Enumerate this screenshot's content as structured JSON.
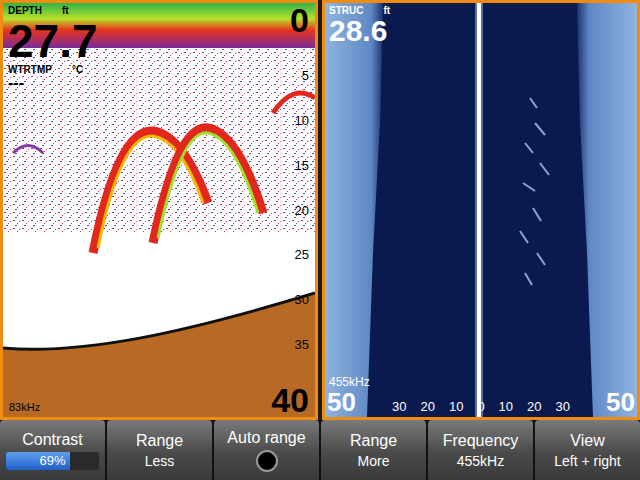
{
  "sonar": {
    "label": "DEPTH",
    "unit": "ft",
    "depth": "27.7",
    "water_temp_label": "WTRTMP",
    "water_temp_unit": "°C",
    "water_temp": "---",
    "frequency": "83kHz",
    "scale": [
      "0",
      "5",
      "10",
      "15",
      "20",
      "25",
      "30",
      "35",
      "40"
    ]
  },
  "structure": {
    "label": "STRUC",
    "unit": "ft",
    "depth": "28.6",
    "frequency": "455kHz",
    "scale": [
      "50",
      "30",
      "20",
      "10",
      "0",
      "10",
      "20",
      "30",
      "50"
    ]
  },
  "softkeys": [
    {
      "label": "Contrast",
      "kind": "level",
      "value": "69%",
      "level": 0.69
    },
    {
      "label": "Range",
      "kind": "text",
      "value": "Less"
    },
    {
      "label": "Auto range",
      "kind": "toggle",
      "on": false
    },
    {
      "label": "Range",
      "kind": "text",
      "value": "More"
    },
    {
      "label": "Frequency",
      "kind": "text",
      "value": "455kHz"
    },
    {
      "label": "View",
      "kind": "text",
      "value": "Left + right"
    }
  ]
}
